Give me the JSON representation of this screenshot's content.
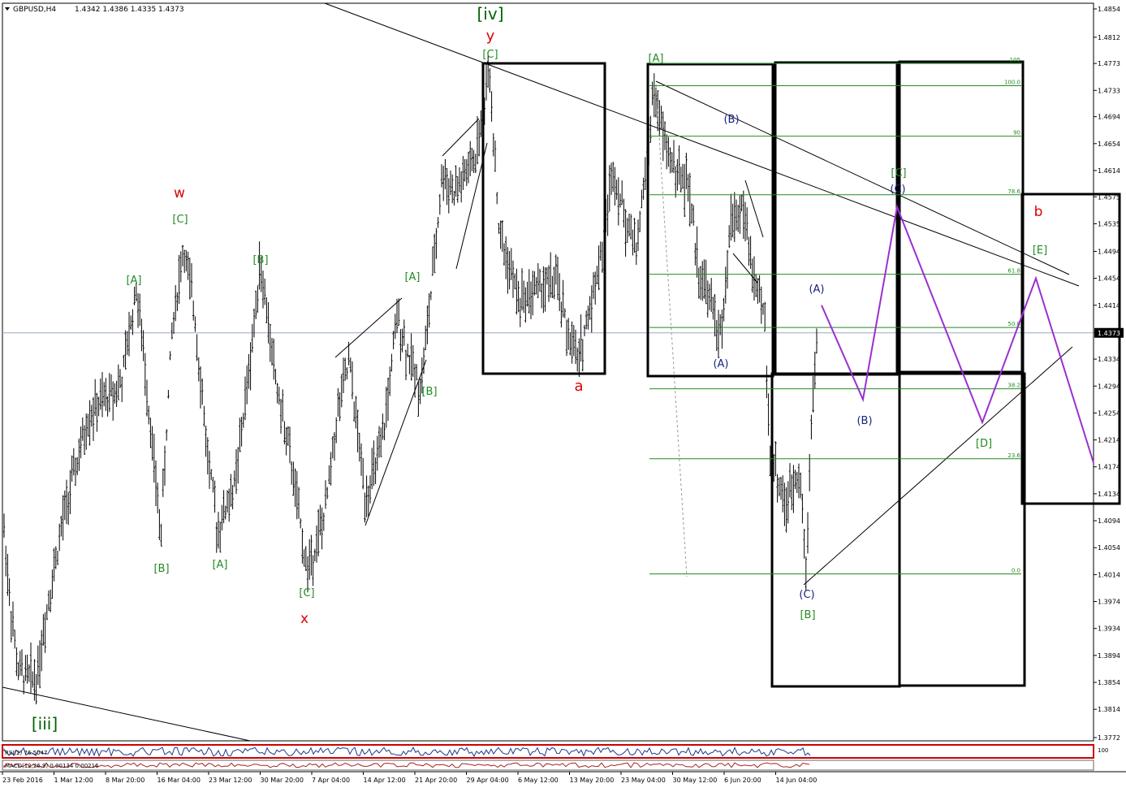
{
  "header": {
    "symbol": "GBPUSD,H4",
    "ohlc": "1.4342 1.4386 1.4335 1.4373"
  },
  "chart_data": {
    "type": "ohlc",
    "symbol": "GBPUSD",
    "timeframe": "H4",
    "ylim": [
      1.3772,
      1.4854
    ],
    "price_ticks": [
      "1.4854",
      "1.4812",
      "1.4773",
      "1.4733",
      "1.4694",
      "1.4654",
      "1.4614",
      "1.4575",
      "1.4535",
      "1.4494",
      "1.4454",
      "1.4414",
      "1.4373",
      "1.4334",
      "1.4294",
      "1.4254",
      "1.4214",
      "1.4174",
      "1.4134",
      "1.4094",
      "1.4054",
      "1.4014",
      "1.3974",
      "1.3934",
      "1.3894",
      "1.3854",
      "1.3814",
      "1.3772"
    ],
    "current_price": "1.4373",
    "time_labels": [
      "23 Feb 2016",
      "1 Mar 12:00",
      "8 Mar 20:00",
      "16 Mar 04:00",
      "23 Mar 12:00",
      "30 Mar 20:00",
      "7 Apr 04:00",
      "14 Apr 12:00",
      "21 Apr 20:00",
      "29 Apr 04:00",
      "6 May 12:00",
      "13 May 20:00",
      "23 May 04:00",
      "30 May 12:00",
      "6 Jun 20:00",
      "14 Jun 04:00"
    ],
    "price_path": [
      [
        0,
        1.415
      ],
      [
        12,
        1.398
      ],
      [
        22,
        1.387
      ],
      [
        45,
        1.386
      ],
      [
        60,
        1.398
      ],
      [
        80,
        1.411
      ],
      [
        110,
        1.425
      ],
      [
        150,
        1.43
      ],
      [
        168,
        1.444
      ],
      [
        182,
        1.428
      ],
      [
        198,
        1.407
      ],
      [
        212,
        1.438
      ],
      [
        226,
        1.45
      ],
      [
        240,
        1.44
      ],
      [
        255,
        1.42
      ],
      [
        268,
        1.408
      ],
      [
        290,
        1.415
      ],
      [
        310,
        1.435
      ],
      [
        320,
        1.448
      ],
      [
        340,
        1.43
      ],
      [
        360,
        1.417
      ],
      [
        378,
        1.402
      ],
      [
        400,
        1.41
      ],
      [
        415,
        1.425
      ],
      [
        430,
        1.433
      ],
      [
        450,
        1.413
      ],
      [
        470,
        1.42
      ],
      [
        490,
        1.44
      ],
      [
        500,
        1.435
      ],
      [
        518,
        1.429
      ],
      [
        530,
        1.442
      ],
      [
        545,
        1.461
      ],
      [
        560,
        1.458
      ],
      [
        585,
        1.463
      ],
      [
        603,
        1.477
      ],
      [
        615,
        1.452
      ],
      [
        640,
        1.442
      ],
      [
        660,
        1.444
      ],
      [
        685,
        1.445
      ],
      [
        700,
        1.437
      ],
      [
        712,
        1.433
      ],
      [
        728,
        1.442
      ],
      [
        742,
        1.45
      ],
      [
        755,
        1.462
      ],
      [
        770,
        1.454
      ],
      [
        785,
        1.45
      ],
      [
        805,
        1.473
      ],
      [
        820,
        1.465
      ],
      [
        835,
        1.461
      ],
      [
        848,
        1.459
      ],
      [
        860,
        1.447
      ],
      [
        875,
        1.442
      ],
      [
        889,
        1.436
      ],
      [
        900,
        1.454
      ],
      [
        915,
        1.456
      ],
      [
        930,
        1.444
      ],
      [
        942,
        1.44
      ],
      [
        948,
        1.42
      ],
      [
        958,
        1.416
      ],
      [
        968,
        1.411
      ],
      [
        985,
        1.418
      ],
      [
        993,
        1.401
      ],
      [
        1000,
        1.427
      ],
      [
        1008,
        1.4373
      ]
    ],
    "wave_labels": [
      {
        "text": "[iv]",
        "color": "#006400"
      },
      {
        "text": "y",
        "color": "#dd0000"
      },
      {
        "text": "[C]",
        "color": "#228b22"
      },
      {
        "text": "w",
        "color": "#dd0000"
      },
      {
        "text": "[C]",
        "color": "#228b22"
      },
      {
        "text": "[A]",
        "color": "#228b22"
      },
      {
        "text": "[B]",
        "color": "#228b22"
      },
      {
        "text": "[B]",
        "color": "#228b22"
      },
      {
        "text": "[A]",
        "color": "#228b22"
      },
      {
        "text": "[C]",
        "color": "#228b22"
      },
      {
        "text": "x",
        "color": "#dd0000"
      },
      {
        "text": "[A]",
        "color": "#228b22"
      },
      {
        "text": "[B]",
        "color": "#228b22"
      },
      {
        "text": "[iii]",
        "color": "#006400"
      },
      {
        "text": "a",
        "color": "#dd0000"
      },
      {
        "text": "[A]",
        "color": "#228b22"
      },
      {
        "text": "(B)",
        "color": "#1a237e"
      },
      {
        "text": "(A)",
        "color": "#1a237e"
      },
      {
        "text": "(A)",
        "color": "#1a237e"
      },
      {
        "text": "(B)",
        "color": "#1a237e"
      },
      {
        "text": "(C)",
        "color": "#1a237e"
      },
      {
        "text": "[B]",
        "color": "#228b22"
      },
      {
        "text": "[C]",
        "color": "#228b22"
      },
      {
        "text": "(C)",
        "color": "#1a237e"
      },
      {
        "text": "[D]",
        "color": "#228b22"
      },
      {
        "text": "[E]",
        "color": "#228b22"
      },
      {
        "text": "b",
        "color": "#dd0000"
      }
    ],
    "fib_levels": [
      {
        "label": "105",
        "price": 1.4773
      },
      {
        "label": "100.0",
        "price": 1.474
      },
      {
        "label": "90",
        "price": 1.4665
      },
      {
        "label": "78.6",
        "price": 1.4578
      },
      {
        "label": "61.8",
        "price": 1.446
      },
      {
        "label": "50.0",
        "price": 1.4381
      },
      {
        "label": "38.2",
        "price": 1.429
      },
      {
        "label": "23.6",
        "price": 1.4186
      },
      {
        "label": "0.0",
        "price": 1.4015
      }
    ],
    "projection_path": [
      [
        1012,
        1.4414
      ],
      [
        1063,
        1.4274
      ],
      [
        1105,
        1.456
      ],
      [
        1210,
        1.424
      ],
      [
        1276,
        1.4454
      ],
      [
        1347,
        1.418
      ]
    ],
    "indicators": {
      "rsi_label": "RSI(2) 76.5047",
      "macd_label": "MACD(12,26,9) 0.00134 0.00216",
      "rsi_scale_top": "100"
    },
    "colors": {
      "bars": "#000000",
      "fib": "#228b22",
      "projection": "#9b30d0",
      "current_line": "#99aabb",
      "rsi_panel": "#cc0000"
    }
  }
}
